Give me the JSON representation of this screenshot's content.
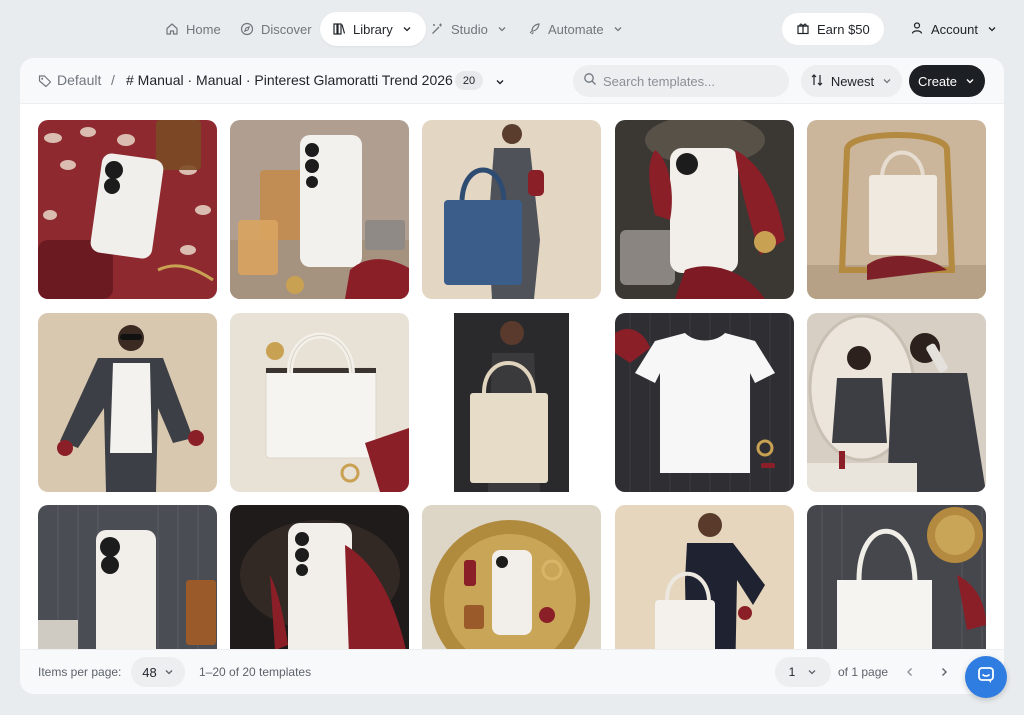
{
  "nav": {
    "home": "Home",
    "discover": "Discover",
    "library": "Library",
    "studio": "Studio",
    "automate": "Automate",
    "earn": "Earn $50",
    "account": "Account"
  },
  "breadcrumb": {
    "root": "Default",
    "separator": "/",
    "title": "# Manual · Manual · Pinterest Glamoratti Trend 2026",
    "count": "20"
  },
  "toolbar": {
    "search_placeholder": "Search templates...",
    "sort_label": "Newest",
    "create_label": "Create"
  },
  "templates": [
    {
      "subject": "white phone case on leopard scarf with red gloves"
    },
    {
      "subject": "white phone case with perfume and red gloves"
    },
    {
      "subject": "woman in grey suit holding denim tote bag"
    },
    {
      "subject": "hand in red glove holding white phone case"
    },
    {
      "subject": "cream tote bag on gilded chair"
    },
    {
      "subject": "woman in sunglasses wearing white tee and grey suit"
    },
    {
      "subject": "white tote bag with leopard scarf"
    },
    {
      "subject": "woman holding canvas tote bag"
    },
    {
      "subject": "white t-shirt flat lay on pinstripe"
    },
    {
      "subject": "woman on phone at vanity mirror"
    },
    {
      "subject": "white phone case with pinstripe fabric"
    },
    {
      "subject": "white phone case held by red glove"
    },
    {
      "subject": "white phone case on gold tray"
    },
    {
      "subject": "woman in navy suit with white tote"
    },
    {
      "subject": "white tote bag on pinstripe with jewelry"
    }
  ],
  "footer": {
    "items_per_page_label": "Items per page:",
    "items_per_page_value": "48",
    "range_text": "1–20 of 20 templates",
    "page_value": "1",
    "page_total": "of 1 page"
  },
  "colors": {
    "background": "#e9ecee",
    "primary_button": "#1c1f23",
    "chat_bubble": "#2f7de1",
    "accent_red": "#9a2430"
  }
}
